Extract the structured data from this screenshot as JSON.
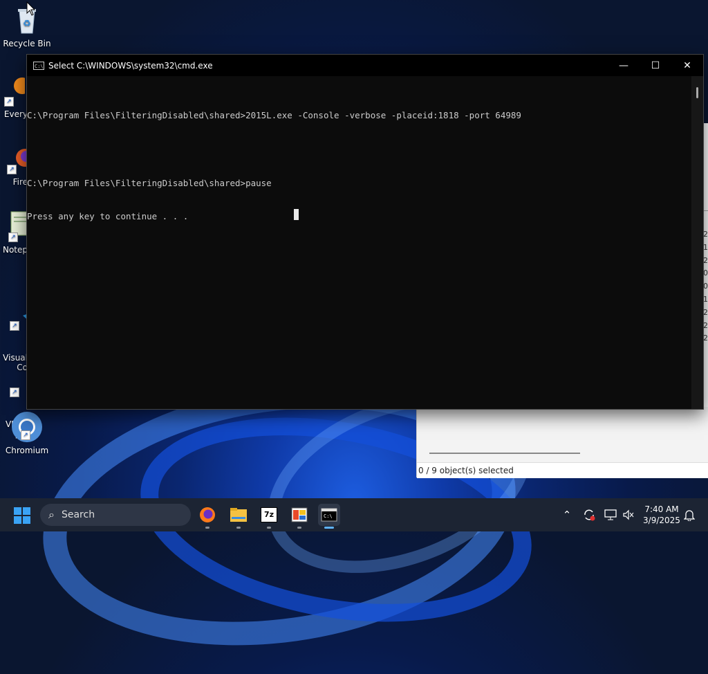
{
  "desktop": {
    "icons": [
      {
        "label": "Recycle Bin"
      },
      {
        "label": "Every"
      },
      {
        "label": "Fire"
      },
      {
        "label": "Notep"
      },
      {
        "label": "Visual\nCo"
      },
      {
        "label": "VLC r\npla"
      },
      {
        "label": "Chromium"
      }
    ]
  },
  "explorer": {
    "status": "0 / 9 object(s) selected",
    "column_fragments": [
      "25",
      "17",
      "25",
      "08",
      "07",
      "17",
      "25",
      "25",
      "25"
    ]
  },
  "cmd": {
    "title": "Select C:\\WINDOWS\\system32\\cmd.exe",
    "title_icon": "C:\\",
    "minimize": "—",
    "maximize": "☐",
    "close": "✕",
    "lines": [
      "C:\\Program Files\\FilteringDisabled\\shared>2015L.exe -Console -verbose -placeid:1818 -port 64989",
      "",
      "C:\\Program Files\\FilteringDisabled\\shared>pause",
      "Press any key to continue . . ."
    ]
  },
  "taskbar": {
    "search_placeholder": "Search",
    "apps": [
      {
        "name": "firefox-icon"
      },
      {
        "name": "file-explorer-icon"
      },
      {
        "name": "7zip-icon",
        "label": "7z"
      },
      {
        "name": "paint-icon"
      },
      {
        "name": "terminal-icon"
      }
    ],
    "clock_time": "7:40 AM",
    "clock_date": "3/9/2025"
  },
  "colors": {
    "accent": "#5fb3ff",
    "cmd_bg": "#0c0c0c",
    "cmd_text": "#cccccc",
    "taskbar_bg": "#1c2433"
  }
}
